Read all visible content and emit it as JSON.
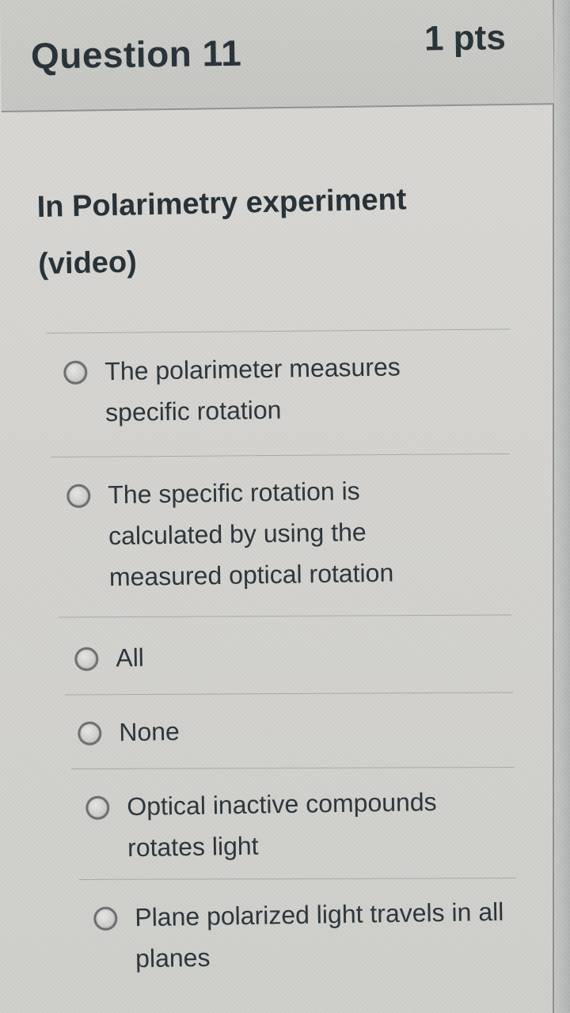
{
  "question": {
    "title": "Question 11",
    "points": "1 pts",
    "prompt": "In Polarimetry experiment (video)"
  },
  "answers": [
    {
      "label": "The polarimeter measures specific rotation",
      "selected": false
    },
    {
      "label": "The specific rotation is calculated by using the measured optical rotation",
      "selected": false
    },
    {
      "label": "All",
      "selected": false
    },
    {
      "label": "None",
      "selected": false
    },
    {
      "label": "Optical inactive compounds rotates light",
      "selected": false
    },
    {
      "label": "Plane polarized light travels in all planes",
      "selected": false
    }
  ]
}
